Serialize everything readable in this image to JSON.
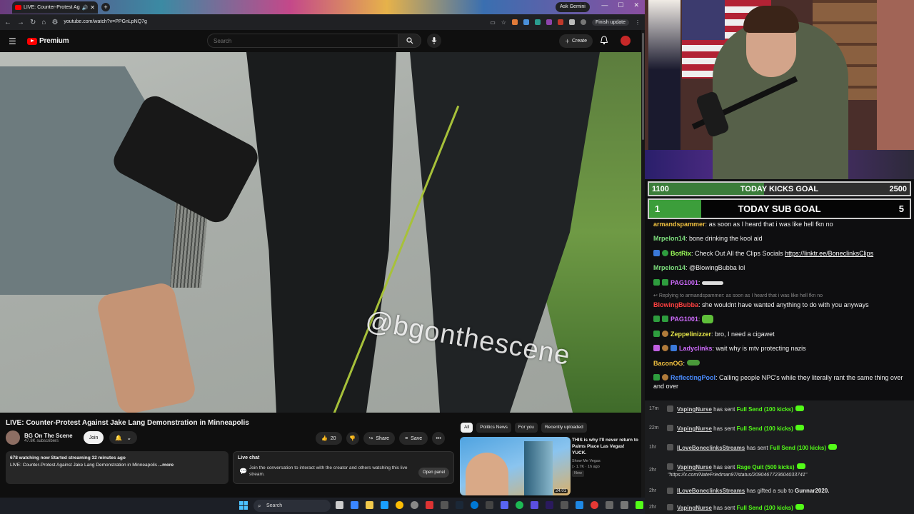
{
  "browser": {
    "tab_title": "LIVE: Counter-Protest Agai",
    "tab_close": "✕",
    "new_tab": "+",
    "ask_gemini": "Ask Gemini",
    "win_min": "—",
    "win_max": "☐",
    "win_close": "✕",
    "url": "youtube.com/watch?v=PPGnLpNQ7g",
    "finish_update": "Finish update"
  },
  "youtube": {
    "logo_text": "Premium",
    "search_placeholder": "Search",
    "create_label": "Create",
    "video_watermark": "@bgonthescene",
    "video_title": "LIVE: Counter-Protest Against Jake Lang Demonstration in Minneapolis",
    "channel_name": "BG On The Scene",
    "channel_subs": "47.8K subscribers",
    "join_label": "Join",
    "like_count": "20",
    "share_label": "Share",
    "save_label": "Save",
    "more_label": "•••",
    "desc_stats": "678 watching now  Started streaming 32 minutes ago",
    "desc_text": "LIVE: Counter-Protest Against Jake Lang Demonstration in Minneapolis ",
    "desc_more": "...more",
    "live_chat_title": "Live chat",
    "live_chat_body": "Join the conversation to interact with the creator and others watching this live stream.",
    "open_panel": "Open panel",
    "chips": [
      "All",
      "Politics News",
      "For you",
      "Recently uploaded"
    ],
    "rec_title": "THIS is why I'll never return to Palms Place Las Vegas! YUCK.",
    "rec_channel": "Show Me Vegas",
    "rec_meta": "▷ 1.7K · 1h ago",
    "rec_new": "New",
    "rec_duration": "24:01"
  },
  "taskbar": {
    "search_label": "Search"
  },
  "stream": {
    "kicks_goal": {
      "current": "1100",
      "label": "TODAY KICKS GOAL",
      "target": "2500",
      "progress": 0.44
    },
    "sub_goal": {
      "current": "1",
      "label": "TODAY SUB GOAL",
      "target": "5",
      "progress": 0.2
    },
    "chat": [
      {
        "user": "armandspammer",
        "color": "#f0c040",
        "text": "as soon as I heard that i was like hell fkn no"
      },
      {
        "user": "Mrpelon14",
        "color": "#7ee07e",
        "text": "bone drinking the kool aid"
      },
      {
        "user": "BotRix",
        "color": "#9cff5a",
        "text": "Check Out All the Clips Socials ",
        "link": "https://linktr.ee/BoneclinksClips"
      },
      {
        "user": "Mrpelon14",
        "color": "#7ee07e",
        "text": "@BlowingBubba lol"
      },
      {
        "user": "PAG1001",
        "color": "#d06cff",
        "text": ""
      },
      {
        "reply_note": "Replying to armandspammer: as soon as I heard that i was like hell fkn no"
      },
      {
        "user": "BlowingBubba",
        "color": "#ff4040",
        "text": "she wouldnt have wanted anything to do with you anyways"
      },
      {
        "user": "PAG1001",
        "color": "#d06cff",
        "text": ""
      },
      {
        "user": "Zeppelinizzer",
        "color": "#e8e84a",
        "text": "bro, I need a cigawet"
      },
      {
        "user": "Ladyclinks",
        "color": "#d06cff",
        "text": "wait why is mtv protecting nazis"
      },
      {
        "user": "BaconOG",
        "color": "#f0c040",
        "text": ""
      },
      {
        "user": "ReflectingPool",
        "color": "#4a8cff",
        "text": "Calling people NPC's while they literally rant the same thing over and over"
      }
    ],
    "events": [
      {
        "time": "17m",
        "user": "VapingNurse",
        "action": "has sent",
        "amount": "Full Send (100 kicks)"
      },
      {
        "time": "22m",
        "user": "VapingNurse",
        "action": "has sent",
        "amount": "Full Send (100 kicks)"
      },
      {
        "time": "1hr",
        "user": "ILoveBoneclinksStreams",
        "action": "has sent",
        "amount": "Full Send (100 kicks)"
      },
      {
        "time": "2hr",
        "user": "VapingNurse",
        "action": "has sent",
        "amount": "Rage Quit (500 kicks)",
        "sub": "\"https://x.com/NateFriedman97/status/2090467723604033741\""
      },
      {
        "time": "2hr",
        "user": "ILoveBoneclinksStreams",
        "action": "has gifted a sub to",
        "gift_to": "Gunnar2020."
      },
      {
        "time": "2hr",
        "user": "VapingNurse",
        "action": "has sent",
        "amount": "Full Send (100 kicks)"
      }
    ]
  }
}
